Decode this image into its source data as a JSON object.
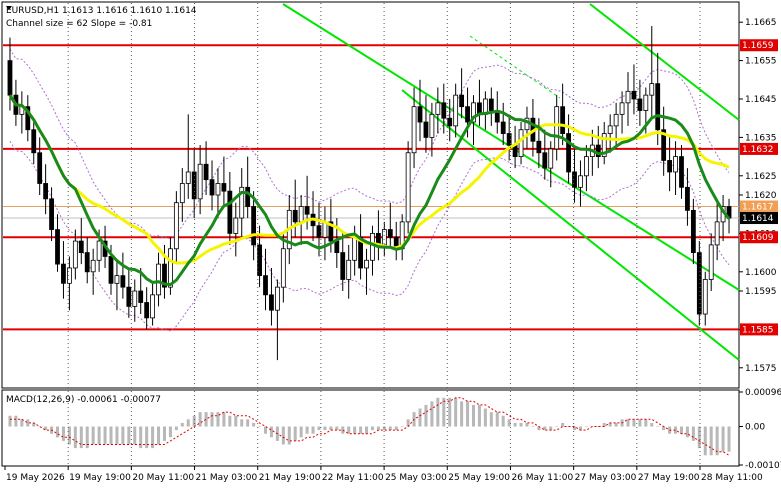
{
  "chart_data": {
    "type": "candlestick",
    "symbol_info": "EURUSD,H1  1.1613 1.1616 1.1610 1.1614",
    "channel_info": "Channel size = 62 Slope = -0.81",
    "price_axis": {
      "min": 1.157,
      "max": 1.167,
      "ticks": [
        "1.1665",
        "1.1655",
        "1.1645",
        "1.1635",
        "1.1625",
        "1.1620",
        "1.1610",
        "1.1600",
        "1.1595",
        "1.1585",
        "1.1575"
      ]
    },
    "time_axis": {
      "labels": [
        "19 May 2026",
        "19 May 19:00",
        "20 May 11:00",
        "21 May 03:00",
        "21 May 19:00",
        "22 May 11:00",
        "25 May 03:00",
        "25 May 19:00",
        "26 May 11:00",
        "27 May 03:00",
        "27 May 19:00",
        "28 May 11:00"
      ]
    },
    "levels": [
      {
        "value": 1.1659,
        "label": "1.1659"
      },
      {
        "value": 1.1632,
        "label": "1.1632"
      },
      {
        "value": 1.1609,
        "label": "1.1609"
      },
      {
        "value": 1.1585,
        "label": "1.1585"
      }
    ],
    "current_price": {
      "value": 1.1614,
      "label": "1.1614"
    },
    "orange_price": {
      "value": 1.1617,
      "label": "1.1617"
    },
    "candles": [
      [
        1.1655,
        1.1661,
        1.1642,
        1.1646
      ],
      [
        1.1646,
        1.165,
        1.1638,
        1.1641
      ],
      [
        1.1641,
        1.1647,
        1.1636,
        1.1643
      ],
      [
        1.1643,
        1.1646,
        1.1634,
        1.1637
      ],
      [
        1.1637,
        1.164,
        1.1628,
        1.1631
      ],
      [
        1.1631,
        1.1635,
        1.162,
        1.1623
      ],
      [
        1.1623,
        1.1628,
        1.1615,
        1.1619
      ],
      [
        1.1619,
        1.1622,
        1.1608,
        1.1611
      ],
      [
        1.1611,
        1.1615,
        1.16,
        1.1602
      ],
      [
        1.1602,
        1.1608,
        1.1593,
        1.1597
      ],
      [
        1.1597,
        1.1604,
        1.159,
        1.1601
      ],
      [
        1.1601,
        1.1611,
        1.1598,
        1.1608
      ],
      [
        1.1608,
        1.1614,
        1.1602,
        1.1605
      ],
      [
        1.1605,
        1.1609,
        1.1597,
        1.16
      ],
      [
        1.16,
        1.1606,
        1.1594,
        1.1603
      ],
      [
        1.1603,
        1.1611,
        1.16,
        1.1608
      ],
      [
        1.1608,
        1.1612,
        1.1601,
        1.1604
      ],
      [
        1.1604,
        1.1607,
        1.1594,
        1.1597
      ],
      [
        1.1597,
        1.1603,
        1.159,
        1.1599
      ],
      [
        1.1599,
        1.1605,
        1.1593,
        1.1596
      ],
      [
        1.1596,
        1.1601,
        1.1588,
        1.1591
      ],
      [
        1.1591,
        1.1598,
        1.1587,
        1.1595
      ],
      [
        1.1595,
        1.1601,
        1.1589,
        1.1592
      ],
      [
        1.1592,
        1.1596,
        1.1585,
        1.1588
      ],
      [
        1.1588,
        1.1597,
        1.1586,
        1.1594
      ],
      [
        1.1594,
        1.1605,
        1.1591,
        1.1602
      ],
      [
        1.1602,
        1.1607,
        1.1593,
        1.1596
      ],
      [
        1.1596,
        1.1609,
        1.1594,
        1.1606
      ],
      [
        1.1606,
        1.1621,
        1.1602,
        1.1618
      ],
      [
        1.1618,
        1.1627,
        1.1613,
        1.1623
      ],
      [
        1.1623,
        1.1641,
        1.1619,
        1.1626
      ],
      [
        1.1626,
        1.1632,
        1.1614,
        1.1619
      ],
      [
        1.1619,
        1.1633,
        1.1615,
        1.1628
      ],
      [
        1.1628,
        1.1634,
        1.162,
        1.1624
      ],
      [
        1.1624,
        1.1629,
        1.1616,
        1.162
      ],
      [
        1.162,
        1.1627,
        1.1614,
        1.1623
      ],
      [
        1.1623,
        1.163,
        1.1617,
        1.1621
      ],
      [
        1.1621,
        1.1626,
        1.1607,
        1.161
      ],
      [
        1.161,
        1.1618,
        1.1604,
        1.1614
      ],
      [
        1.1614,
        1.1627,
        1.1609,
        1.1622
      ],
      [
        1.1622,
        1.163,
        1.1614,
        1.1617
      ],
      [
        1.1617,
        1.1621,
        1.1603,
        1.1607
      ],
      [
        1.1607,
        1.1612,
        1.1596,
        1.1599
      ],
      [
        1.1599,
        1.1606,
        1.159,
        1.1594
      ],
      [
        1.1594,
        1.1601,
        1.1586,
        1.159
      ],
      [
        1.159,
        1.1598,
        1.1577,
        1.1596
      ],
      [
        1.1596,
        1.161,
        1.1592,
        1.1606
      ],
      [
        1.1606,
        1.162,
        1.1602,
        1.1616
      ],
      [
        1.1616,
        1.1624,
        1.1609,
        1.1613
      ],
      [
        1.1613,
        1.162,
        1.1607,
        1.1617
      ],
      [
        1.1617,
        1.1625,
        1.1611,
        1.1615
      ],
      [
        1.1615,
        1.1621,
        1.1608,
        1.1612
      ],
      [
        1.1612,
        1.1618,
        1.1604,
        1.1609
      ],
      [
        1.1609,
        1.1617,
        1.1603,
        1.1613
      ],
      [
        1.1613,
        1.1619,
        1.1605,
        1.1608
      ],
      [
        1.1608,
        1.1614,
        1.1601,
        1.1605
      ],
      [
        1.1605,
        1.161,
        1.1595,
        1.1598
      ],
      [
        1.1598,
        1.1607,
        1.1593,
        1.1603
      ],
      [
        1.1603,
        1.1612,
        1.1599,
        1.1609
      ],
      [
        1.1609,
        1.1615,
        1.1598,
        1.1601
      ],
      [
        1.1601,
        1.1606,
        1.1594,
        1.1603
      ],
      [
        1.1603,
        1.1612,
        1.1599,
        1.161
      ],
      [
        1.161,
        1.1616,
        1.1603,
        1.1607
      ],
      [
        1.1607,
        1.1613,
        1.1604,
        1.1611
      ],
      [
        1.1611,
        1.1618,
        1.1606,
        1.1609
      ],
      [
        1.1609,
        1.1613,
        1.1603,
        1.1606
      ],
      [
        1.1606,
        1.1615,
        1.1603,
        1.1613
      ],
      [
        1.1613,
        1.1634,
        1.161,
        1.1631
      ],
      [
        1.1631,
        1.1648,
        1.1627,
        1.1643
      ],
      [
        1.1643,
        1.165,
        1.1634,
        1.1639
      ],
      [
        1.1639,
        1.1646,
        1.1631,
        1.1635
      ],
      [
        1.1635,
        1.1644,
        1.163,
        1.1641
      ],
      [
        1.1641,
        1.1648,
        1.1636,
        1.1644
      ],
      [
        1.1644,
        1.1649,
        1.1636,
        1.164
      ],
      [
        1.164,
        1.1645,
        1.1634,
        1.1638
      ],
      [
        1.1638,
        1.1649,
        1.1635,
        1.1646
      ],
      [
        1.1646,
        1.1653,
        1.164,
        1.1643
      ],
      [
        1.1643,
        1.1648,
        1.1635,
        1.1639
      ],
      [
        1.1639,
        1.1646,
        1.1633,
        1.1644
      ],
      [
        1.1644,
        1.165,
        1.1638,
        1.1641
      ],
      [
        1.1641,
        1.1647,
        1.1637,
        1.1645
      ],
      [
        1.1645,
        1.1648,
        1.1638,
        1.1642
      ],
      [
        1.1642,
        1.1647,
        1.1636,
        1.1639
      ],
      [
        1.1639,
        1.1644,
        1.1633,
        1.1636
      ],
      [
        1.1636,
        1.1641,
        1.1629,
        1.1633
      ],
      [
        1.1633,
        1.1638,
        1.1627,
        1.163
      ],
      [
        1.163,
        1.1639,
        1.1628,
        1.1637
      ],
      [
        1.1637,
        1.1643,
        1.1632,
        1.164
      ],
      [
        1.164,
        1.1645,
        1.163,
        1.1634
      ],
      [
        1.1634,
        1.164,
        1.1627,
        1.1631
      ],
      [
        1.1631,
        1.1637,
        1.1624,
        1.1627
      ],
      [
        1.1627,
        1.1634,
        1.1622,
        1.1632
      ],
      [
        1.1632,
        1.1646,
        1.1629,
        1.1643
      ],
      [
        1.1643,
        1.1649,
        1.1633,
        1.1636
      ],
      [
        1.1636,
        1.1641,
        1.1623,
        1.1626
      ],
      [
        1.1626,
        1.1632,
        1.1618,
        1.1622
      ],
      [
        1.1622,
        1.1629,
        1.1617,
        1.1625
      ],
      [
        1.1625,
        1.1633,
        1.1621,
        1.163
      ],
      [
        1.163,
        1.1637,
        1.1625,
        1.1633
      ],
      [
        1.1633,
        1.1638,
        1.1627,
        1.163
      ],
      [
        1.163,
        1.1639,
        1.1628,
        1.1636
      ],
      [
        1.1636,
        1.1641,
        1.1631,
        1.1638
      ],
      [
        1.1638,
        1.1644,
        1.1632,
        1.1641
      ],
      [
        1.1641,
        1.1647,
        1.1636,
        1.1644
      ],
      [
        1.1644,
        1.1652,
        1.1638,
        1.1647
      ],
      [
        1.1647,
        1.1654,
        1.1641,
        1.1645
      ],
      [
        1.1645,
        1.165,
        1.1638,
        1.1642
      ],
      [
        1.1642,
        1.1648,
        1.1636,
        1.1646
      ],
      [
        1.1646,
        1.1664,
        1.164,
        1.1649
      ],
      [
        1.1649,
        1.1657,
        1.1633,
        1.1637
      ],
      [
        1.1637,
        1.1643,
        1.1625,
        1.1629
      ],
      [
        1.1629,
        1.1635,
        1.1621,
        1.1626
      ],
      [
        1.1626,
        1.1634,
        1.162,
        1.163
      ],
      [
        1.163,
        1.1633,
        1.1619,
        1.1622
      ],
      [
        1.1622,
        1.1627,
        1.1612,
        1.1616
      ],
      [
        1.1616,
        1.1619,
        1.1602,
        1.1605
      ],
      [
        1.1605,
        1.1608,
        1.1586,
        1.1589
      ],
      [
        1.1589,
        1.16,
        1.1586,
        1.1598
      ],
      [
        1.1598,
        1.161,
        1.1595,
        1.1607
      ],
      [
        1.1607,
        1.1618,
        1.1603,
        1.1613
      ],
      [
        1.1613,
        1.162,
        1.1608,
        1.1617
      ],
      [
        1.1617,
        1.1619,
        1.161,
        1.1614
      ]
    ],
    "macd": {
      "label": "MACD(12,26,9) -0.00061 -0.00077",
      "axis_min": -0.00107,
      "axis_max": 0.00096,
      "ticks": [
        "0.00096",
        "0.00",
        "-0.00107"
      ],
      "histogram": [
        0.0003,
        0.0003,
        0.0002,
        0.0002,
        0.0001,
        0.0,
        -0.0001,
        -0.0002,
        -0.0003,
        -0.0004,
        -0.0005,
        -0.0006,
        -0.0006,
        -0.0006,
        -0.0005,
        -0.0005,
        -0.0005,
        -0.0005,
        -0.0005,
        -0.0005,
        -0.0005,
        -0.0005,
        -0.0006,
        -0.0006,
        -0.0006,
        -0.0005,
        -0.0004,
        -0.0003,
        -0.0001,
        0.0001,
        0.0002,
        0.0003,
        0.0004,
        0.0004,
        0.0004,
        0.0004,
        0.0004,
        0.0003,
        0.0003,
        0.0002,
        0.0002,
        0.0001,
        0.0,
        -0.0002,
        -0.0003,
        -0.0004,
        -0.0005,
        -0.0005,
        -0.0004,
        -0.0003,
        -0.0002,
        -0.0002,
        -0.0001,
        -0.0001,
        -0.0001,
        -0.0001,
        -0.0002,
        -0.0002,
        -0.0002,
        -0.0002,
        -0.0002,
        -0.0001,
        -0.0001,
        -0.0001,
        -0.0001,
        -0.0001,
        0.0,
        0.0002,
        0.0004,
        0.0005,
        0.0006,
        0.0007,
        0.0008,
        0.0008,
        0.0008,
        0.0008,
        0.0007,
        0.0007,
        0.0006,
        0.0006,
        0.0005,
        0.0004,
        0.0004,
        0.0003,
        0.0002,
        0.0001,
        0.0001,
        0.0001,
        0.0,
        -0.0001,
        -0.0001,
        -0.0001,
        0.0,
        0.0001,
        0.0,
        -0.0001,
        -0.0001,
        0.0,
        0.0,
        0.0,
        0.0001,
        0.0001,
        0.0001,
        0.0002,
        0.0002,
        0.0002,
        0.0002,
        0.0002,
        0.0001,
        0.0,
        -0.0001,
        -0.0002,
        -0.0002,
        -0.0002,
        -0.0003,
        -0.0004,
        -0.0006,
        -0.0008,
        -0.0008,
        -0.0008,
        -0.0007,
        -0.0007
      ],
      "signal": [
        0.0002,
        0.0002,
        0.0002,
        0.0001,
        0.0001,
        0.0,
        -0.0001,
        -0.0001,
        -0.0002,
        -0.0003,
        -0.0003,
        -0.0004,
        -0.0005,
        -0.0005,
        -0.0005,
        -0.0005,
        -0.0005,
        -0.0005,
        -0.0005,
        -0.0005,
        -0.0005,
        -0.0005,
        -0.0005,
        -0.0005,
        -0.0005,
        -0.0005,
        -0.0005,
        -0.0004,
        -0.0003,
        -0.0002,
        -0.0001,
        0.0,
        0.0001,
        0.0002,
        0.0003,
        0.0003,
        0.0004,
        0.0004,
        0.0003,
        0.0003,
        0.0003,
        0.0002,
        0.0001,
        0.0,
        -0.0001,
        -0.0002,
        -0.0003,
        -0.0004,
        -0.0004,
        -0.0004,
        -0.0003,
        -0.0003,
        -0.0002,
        -0.0002,
        -0.0001,
        -0.0001,
        -0.0001,
        -0.0002,
        -0.0002,
        -0.0002,
        -0.0002,
        -0.0002,
        -0.0001,
        -0.0001,
        -0.0001,
        -0.0001,
        -0.0001,
        0.0,
        0.0002,
        0.0003,
        0.0004,
        0.0005,
        0.0006,
        0.0007,
        0.0007,
        0.0008,
        0.0008,
        0.0007,
        0.0007,
        0.0006,
        0.0006,
        0.0005,
        0.0004,
        0.0004,
        0.0003,
        0.0002,
        0.0002,
        0.0001,
        0.0001,
        0.0,
        -0.0001,
        -0.0001,
        -0.0001,
        0.0,
        0.0,
        0.0,
        -0.0001,
        -0.0001,
        0.0,
        0.0,
        0.0,
        0.0001,
        0.0001,
        0.0001,
        0.0002,
        0.0002,
        0.0002,
        0.0002,
        0.0002,
        0.0001,
        0.0,
        -0.0001,
        -0.0001,
        -0.0002,
        -0.0002,
        -0.0003,
        -0.0004,
        -0.0005,
        -0.0006,
        -0.0007,
        -0.0007,
        -0.0008
      ]
    }
  }
}
